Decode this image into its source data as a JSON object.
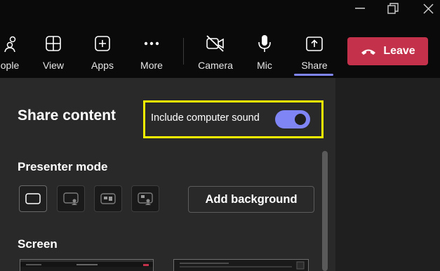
{
  "toolbar": {
    "items": [
      {
        "label": "ople",
        "icon": "people-icon"
      },
      {
        "label": "View",
        "icon": "grid-view-icon"
      },
      {
        "label": "Apps",
        "icon": "add-apps-icon"
      },
      {
        "label": "More",
        "icon": "more-dots-icon"
      },
      {
        "label": "Camera",
        "icon": "camera-off-icon"
      },
      {
        "label": "Mic",
        "icon": "microphone-icon"
      },
      {
        "label": "Share",
        "icon": "share-tray-icon",
        "active": true
      }
    ],
    "leave_label": "Leave"
  },
  "share_panel": {
    "title": "Share content",
    "include_sound": {
      "label": "Include computer sound",
      "on": true
    },
    "presenter_mode": {
      "title": "Presenter mode",
      "options": [
        "content-only",
        "standout",
        "side-by-side",
        "reporter"
      ],
      "selected": "content-only"
    },
    "add_background_label": "Add background",
    "screen_title": "Screen"
  },
  "colors": {
    "accent": "#7f85f5",
    "leave": "#c4314b",
    "highlight": "#f5f000",
    "panel": "#292929",
    "toolbar": "#0a0a0a"
  }
}
